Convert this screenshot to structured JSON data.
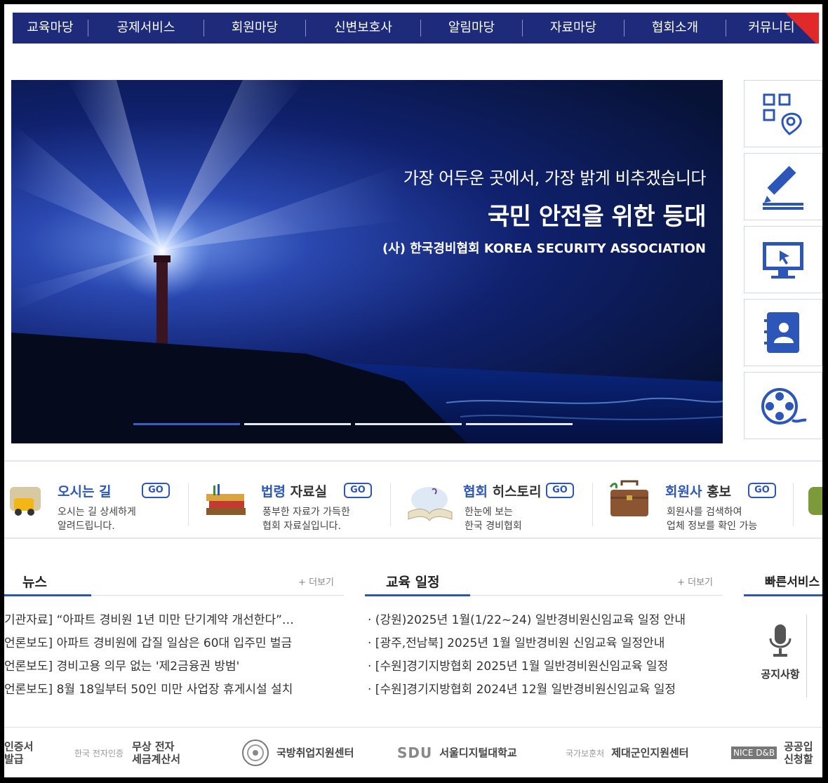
{
  "nav": {
    "items": [
      "교육마당",
      "공제서비스",
      "회원마당",
      "신변보호사",
      "알림마당",
      "자료마당",
      "협회소개",
      "커뮤니티"
    ]
  },
  "hero": {
    "line1": "가장 어두운 곳에서, 가장 밝게 비추겠습니다",
    "line2": "국민 안전을 위한 등대",
    "line3": "(사) 한국경비협회  KOREA SECURITY ASSOCIATION",
    "slide_count": 4,
    "active_slide": 1
  },
  "quick_icons": [
    "qr-location-icon",
    "edit-icon",
    "monitor-icon",
    "contact-book-icon",
    "film-reel-icon"
  ],
  "link_band": [
    {
      "title_blue": "오시는 길",
      "title_dark": "",
      "go": "GO",
      "desc1": "오시는 길 상세하게",
      "desc2": "알려드립니다.",
      "icon": "car-map-icon"
    },
    {
      "title_blue": "법령",
      "title_dark": " 자료실",
      "go": "GO",
      "desc1": "풍부한 자료가 가득한",
      "desc2": "협회 자료실입니다.",
      "icon": "books-icon"
    },
    {
      "title_blue": "협회",
      "title_dark": " 히스토리",
      "go": "GO",
      "desc1": "한눈에 보는",
      "desc2": "한국 경비협회",
      "icon": "open-book-icon"
    },
    {
      "title_blue": "회원사",
      "title_dark": " 홍보",
      "go": "GO",
      "desc1": "회원사를 검색하여",
      "desc2": "업체 정보를 확인 가능",
      "icon": "briefcase-icon"
    }
  ],
  "news": {
    "title": "뉴스",
    "more": "+ 더보기",
    "items": [
      "기관자료] “아파트 경비원 1년 미만 단기계약 개선한다”…",
      "언론보도] 아파트 경비원에 갑질 일삼은 60대 입주민 벌금",
      "언론보도] 경비고용 의무 없는 '제2금융권 방범'",
      "언론보도] 8월 18일부터 50인 미만 사업장 휴게시설 설치"
    ]
  },
  "schedule": {
    "title": "교육 일정",
    "more": "+ 더보기",
    "items": [
      "· (강원)2025년 1월(1/22~24) 일반경비원신임교육 일정 안내",
      "· [광주,전남북] 2025년 1월 일반경비원 신임교육 일정안내",
      "· [수원]경기지방협회 2025년 1월 일반경비원신임교육 일정",
      "· [수원]경기지방협회 2024년 12월 일반경비원신임교육 일정"
    ]
  },
  "fast_service": {
    "title": "빠른서비스",
    "item_label": "공지사항",
    "item_icon": "microphone-icon"
  },
  "footer_banners": [
    {
      "line1": "인증서",
      "line2": "발급"
    },
    {
      "small": "한국 전자인증",
      "line1": "무상 전자",
      "line2": "세금계산서"
    },
    {
      "line1": "국방취업지원센터"
    },
    {
      "small": "SDU",
      "line1": "서울디지털대학교"
    },
    {
      "small": "국가보훈처",
      "line1": "제대군인지원센터"
    },
    {
      "small": "NICE D&B",
      "line1": "공공입",
      "line2": "신청할"
    }
  ]
}
